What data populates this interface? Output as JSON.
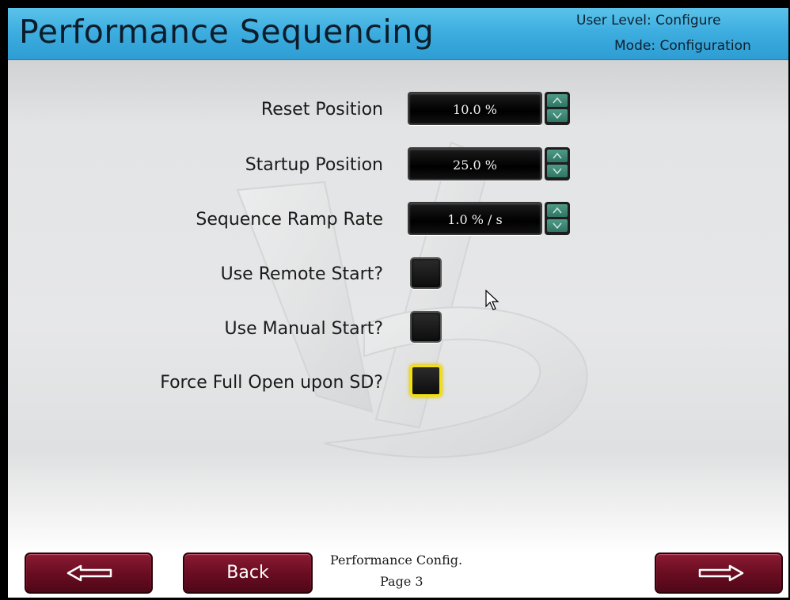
{
  "header": {
    "title": "Performance Sequencing",
    "user_level": "User Level: Configure",
    "mode": "Mode: Configuration"
  },
  "settings": [
    {
      "label": "Reset Position",
      "value": "10.0 %"
    },
    {
      "label": "Startup Position",
      "value": "25.0 %"
    },
    {
      "label": "Sequence Ramp Rate",
      "value": "1.0 % / s"
    }
  ],
  "checkboxes": [
    {
      "label": "Use Remote Start?",
      "checked": false
    },
    {
      "label": "Use Manual Start?",
      "checked": false
    },
    {
      "label": "Force Full Open upon SD?",
      "checked": false,
      "focused": true
    }
  ],
  "footer": {
    "back_label": "Back",
    "page_name": "Performance Config.",
    "page_number": "Page 3",
    "prev_icon": "arrow-left-icon",
    "next_icon": "arrow-right-icon"
  },
  "colors": {
    "header": "#3eaee0",
    "nav_button": "#6a0d22",
    "spinner": "#2f7565",
    "focus": "#f4e00a"
  }
}
